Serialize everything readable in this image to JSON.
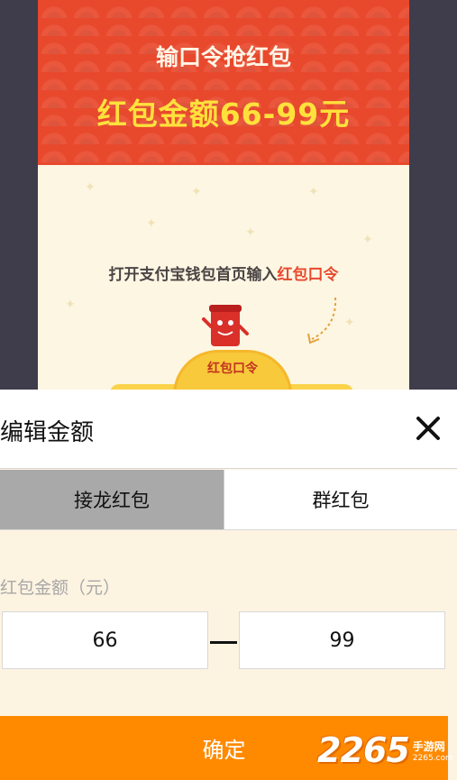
{
  "background_card": {
    "header_title": "输口令抢红包",
    "amount_banner": "红包金额66-99元",
    "instruction_prefix": "打开支付宝钱包首页输入",
    "instruction_highlight": "红包口令",
    "coin_label": "红包口令"
  },
  "dialog": {
    "title": "编辑金额",
    "close_icon": "close-icon",
    "tabs": [
      {
        "label": "接龙红包",
        "active": true
      },
      {
        "label": "群红包",
        "active": false
      }
    ],
    "amount_label": "红包金额（元）",
    "min_value": "66",
    "max_value": "99",
    "confirm_label": "确定"
  },
  "watermark": {
    "number": "2265",
    "suffix_cn": "手游网",
    "suffix_en": "2265.com"
  },
  "colors": {
    "header_red": "#e8492d",
    "banner_yellow": "#ffe13c",
    "confirm_orange": "#ff8a00",
    "active_tab_gray": "#a9a9a9",
    "dialog_bg": "#fdf3e1",
    "overlay_dark": "#3f3c4b"
  }
}
